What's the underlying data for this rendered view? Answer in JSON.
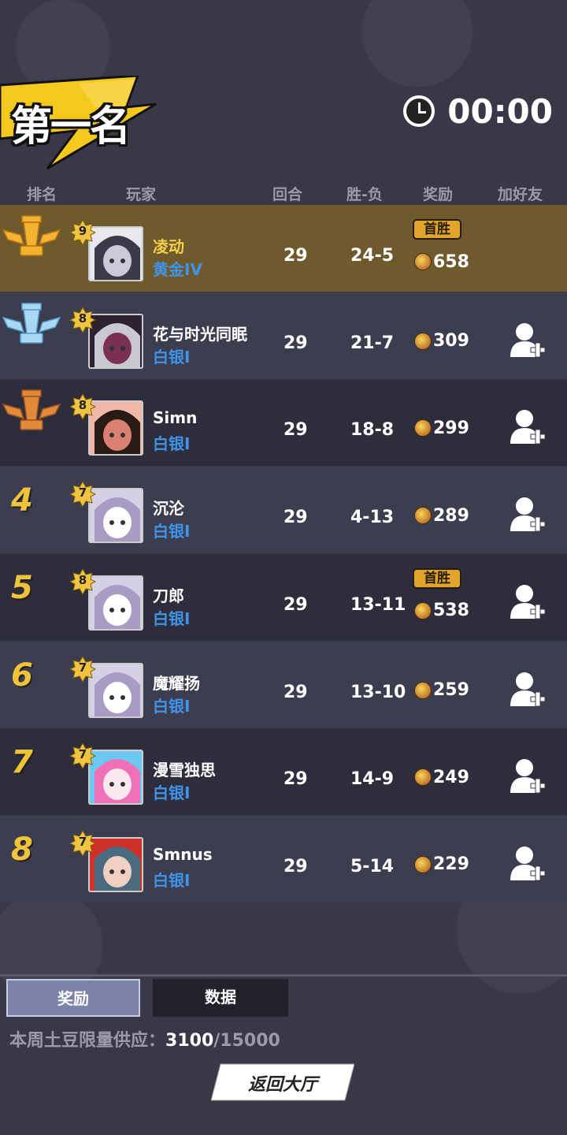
{
  "header": {
    "placement_title": "第一名",
    "timer": "00:00"
  },
  "columns": {
    "rank": "排名",
    "player": "玩家",
    "rounds": "回合",
    "win_loss": "胜-负",
    "reward": "奖励",
    "add_friend": "加好友"
  },
  "rows": [
    {
      "rank": "1",
      "trophy": "gold-trophy-icon",
      "level": "9",
      "name": "凌动",
      "tier": "黄金IV",
      "rounds": "29",
      "win_loss": "24-5",
      "reward": "658",
      "first_win": "首胜",
      "highlight": true,
      "add_friend": false
    },
    {
      "rank": "2",
      "trophy": "silver-trophy-icon",
      "level": "8",
      "name": "花与时光同眠",
      "tier": "白银I",
      "rounds": "29",
      "win_loss": "21-7",
      "reward": "309",
      "add_friend": true
    },
    {
      "rank": "3",
      "trophy": "bronze-trophy-icon",
      "level": "8",
      "name": "Simn",
      "tier": "白银I",
      "rounds": "29",
      "win_loss": "18-8",
      "reward": "299",
      "add_friend": true
    },
    {
      "rank": "4",
      "level": "7",
      "name": "沉沦",
      "tier": "白银I",
      "rounds": "29",
      "win_loss": "4-13",
      "reward": "289",
      "add_friend": true
    },
    {
      "rank": "5",
      "level": "8",
      "name": "刀郎",
      "tier": "白银I",
      "rounds": "29",
      "win_loss": "13-11",
      "reward": "538",
      "first_win": "首胜",
      "add_friend": true
    },
    {
      "rank": "6",
      "level": "7",
      "name": "魔耀扬",
      "tier": "白银I",
      "rounds": "29",
      "win_loss": "13-10",
      "reward": "259",
      "add_friend": true
    },
    {
      "rank": "7",
      "level": "7",
      "name": "漫雪独思",
      "tier": "白银I",
      "rounds": "29",
      "win_loss": "14-9",
      "reward": "249",
      "add_friend": true
    },
    {
      "rank": "8",
      "level": "7",
      "name": "Smnus",
      "tier": "白银I",
      "rounds": "29",
      "win_loss": "5-14",
      "reward": "229",
      "add_friend": true
    }
  ],
  "tabs": {
    "reward": "奖励",
    "data": "数据"
  },
  "supply": {
    "label": "本周土豆限量供应：",
    "current": "3100",
    "total": "/15000"
  },
  "back_button": "返回大厅",
  "colors": {
    "background": "#383849",
    "highlight_row": "#6e5a2c",
    "tier_blue": "#3f93e8",
    "rank_gold": "#f0c43a"
  }
}
